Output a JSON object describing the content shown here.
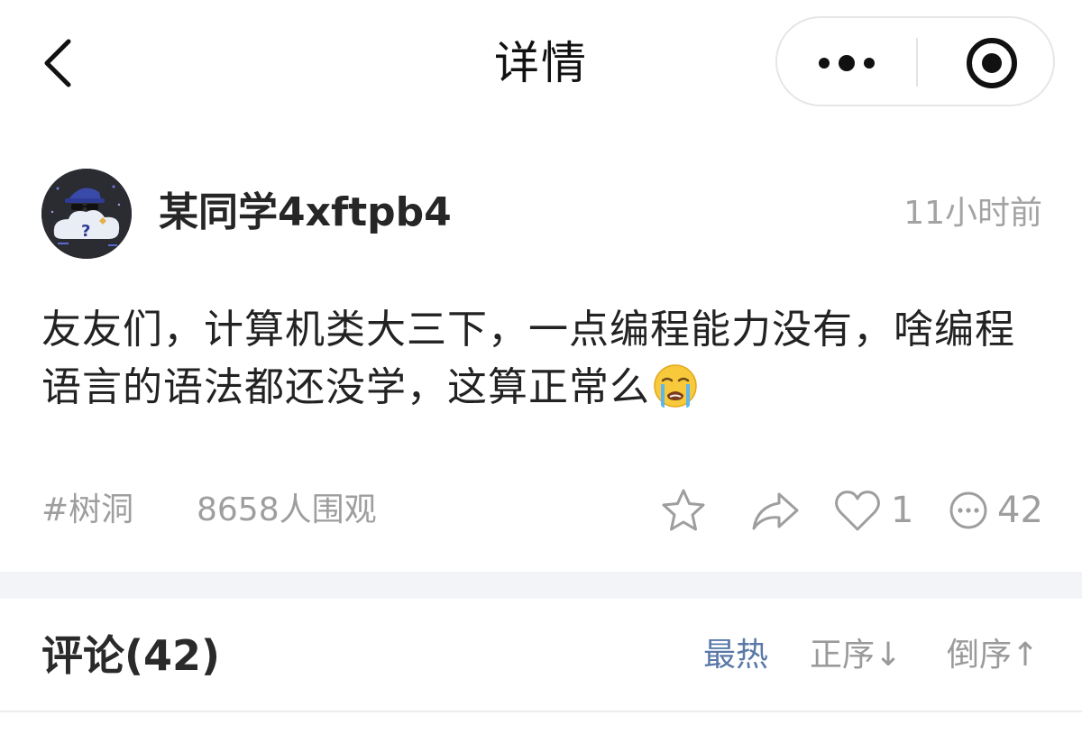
{
  "navbar": {
    "title": "详情",
    "back_icon": "chevron-left-icon",
    "more_icon": "more-dots-icon",
    "close_icon": "target-circle-icon"
  },
  "post": {
    "author": "某同学4xftpb4",
    "time": "11小时前",
    "content": "友友们，计算机类大三下，一点编程能力没有，啥编程语言的语法都还没学，这算正常么",
    "emoji": "crying-face-emoji",
    "tag": "#树洞",
    "views": "8658人围观",
    "actions": {
      "favorite_icon": "star-icon",
      "share_icon": "share-arrow-icon",
      "like_icon": "heart-icon",
      "like_count": "1",
      "comment_icon": "comment-bubble-icon",
      "comment_count": "42"
    }
  },
  "comments": {
    "title": "评论(42)",
    "sort_options": [
      "最热",
      "正序↓",
      "倒序↑"
    ],
    "active_sort": "最热"
  },
  "colors": {
    "accent_sort": "#5a79a8",
    "muted_text": "#9e9e9e",
    "separator": "#f3f4f8"
  }
}
